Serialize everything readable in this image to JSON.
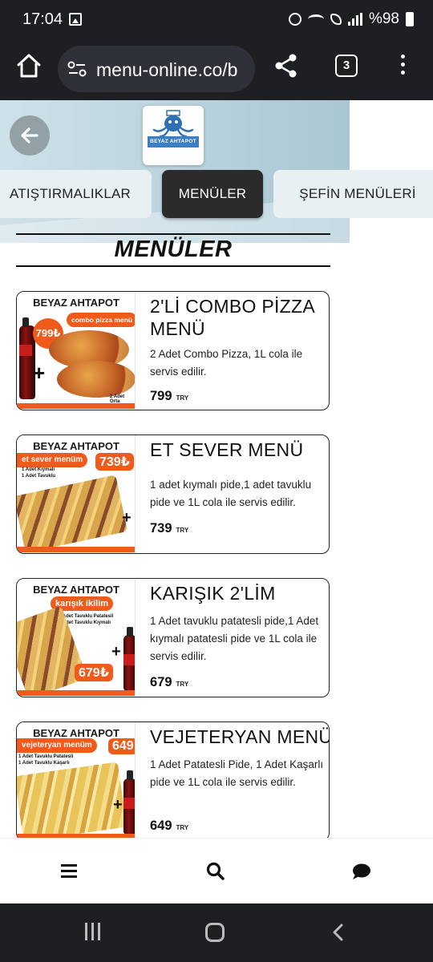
{
  "status_bar": {
    "time": "17:04",
    "battery": "%98"
  },
  "browser": {
    "url": "menu-online.co/b",
    "tab_count": "3"
  },
  "hero": {
    "logo_text": "BEYAZ AHTAPOT"
  },
  "categories": [
    {
      "label": "ATIŞTIRMALIKLAR",
      "active": false
    },
    {
      "label": "MENÜLER",
      "active": true
    },
    {
      "label": "ŞEFİN MENÜLERİ",
      "active": false
    }
  ],
  "section_title": "MENÜLER",
  "items": [
    {
      "name": "2'Lİ COMBO PİZZA MENÜ",
      "description": "2 Adet Combo Pizza, 1L cola ile servis edilir.",
      "price": "799",
      "currency": "TRY",
      "image": {
        "brand": "BEYAZ AHTAPOT",
        "badge": "combo pizza menü",
        "price_badge": "799₺",
        "caption": "2 Adet Orta"
      }
    },
    {
      "name": "ET SEVER MENÜ",
      "description": "1 adet kıymalı pide,1 adet tavuklu pide ve 1L cola ile servis edilir.",
      "price": "739",
      "currency": "TRY",
      "image": {
        "brand": "BEYAZ AHTAPOT",
        "badge": "et sever menüm",
        "price_badge": "739₺",
        "line1": "1 Adet Kıymalı",
        "line2": "1 Adet Tavuklu"
      }
    },
    {
      "name": "KARIŞIK 2'LİM",
      "description": "1 Adet tavuklu patatesli pide,1 Adet kıymalı patatesli pide ve 1L cola ile servis edilir.",
      "price": "679",
      "currency": "TRY",
      "image": {
        "brand": "BEYAZ AHTAPOT",
        "badge": "karışık ikilim",
        "price_badge": "679₺",
        "line1": "1 Adet Tavuklu Patatesli",
        "line2": "1 Adet Tavuklu Kıymalı"
      }
    },
    {
      "name": "VEJETERYAN MENÜ",
      "description": "1 Adet Patatesli Pide, 1 Adet Kaşarlı pide ve 1L cola ile servis edilir.",
      "price": "649",
      "currency": "TRY",
      "image": {
        "brand": "BEYAZ AHTAPOT",
        "badge": "vejeteryan menüm",
        "price_badge": "649",
        "line1": "1 Adet Tavuklu Patatesli",
        "line2": "1 Adet Tavuklu Kaşarlı"
      }
    }
  ],
  "colors": {
    "accent": "#f05a1a",
    "active_tab": "#2b2b2b",
    "chrome": "#1d1f23"
  }
}
